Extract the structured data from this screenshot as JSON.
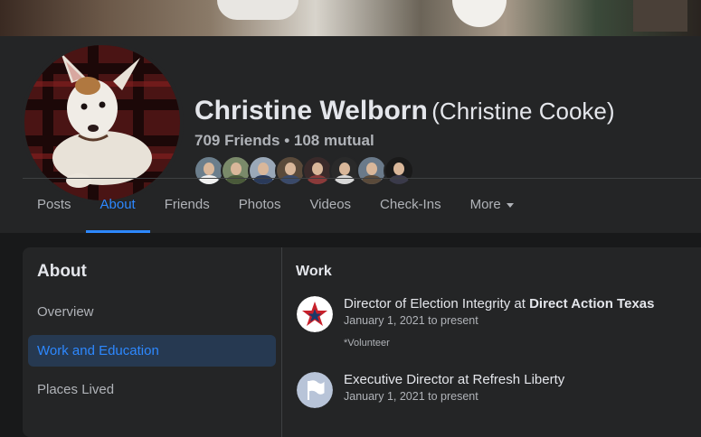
{
  "profile": {
    "name": "Christine Welborn",
    "alt_name": "(Christine Cooke)",
    "friends_summary": "709 Friends • 108 mutual"
  },
  "nav": {
    "tabs": [
      {
        "label": "Posts"
      },
      {
        "label": "About"
      },
      {
        "label": "Friends"
      },
      {
        "label": "Photos"
      },
      {
        "label": "Videos"
      },
      {
        "label": "Check-Ins"
      },
      {
        "label": "More"
      }
    ],
    "active": "About"
  },
  "about": {
    "title": "About",
    "items": [
      {
        "label": "Overview"
      },
      {
        "label": "Work and Education"
      },
      {
        "label": "Places Lived"
      }
    ]
  },
  "work": {
    "title": "Work",
    "jobs": [
      {
        "title": "Director of Election Integrity at",
        "company": "Direct Action Texas",
        "date": "January 1, 2021 to present",
        "note": "*Volunteer"
      },
      {
        "title": "Executive Director at Refresh Liberty",
        "date": "January 1, 2021 to present"
      }
    ]
  },
  "colors": {
    "accent": "#2d88ff",
    "background": "#18191a",
    "surface": "#242526",
    "active_bg": "#263951"
  }
}
